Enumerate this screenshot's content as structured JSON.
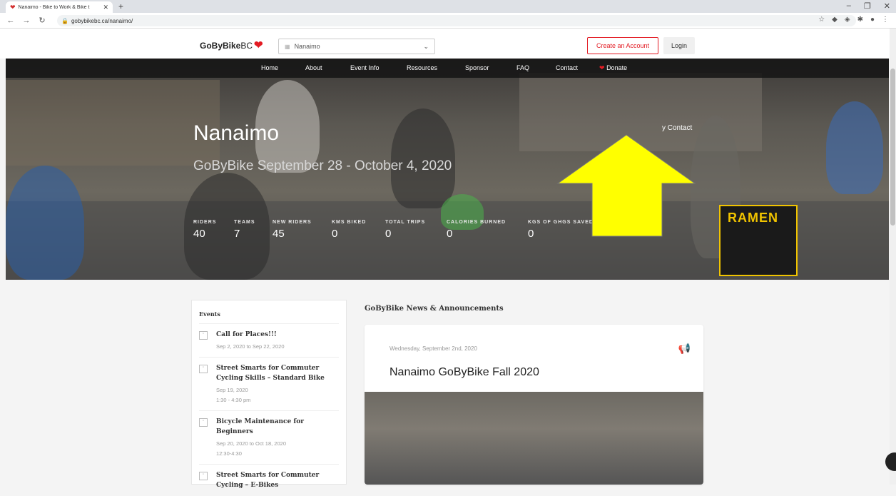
{
  "browser": {
    "tab_title": "Nanaimo - Bike to Work & Bike t",
    "url": "gobybikebc.ca/nanaimo/"
  },
  "header": {
    "logo_text": "GoByBike",
    "logo_suffix": "BC",
    "city_select": "Nanaimo",
    "create_account": "Create an Account",
    "login": "Login"
  },
  "nav": {
    "items": [
      "Home",
      "About",
      "Event Info",
      "Resources",
      "Sponsor",
      "FAQ",
      "Contact",
      "Donate"
    ]
  },
  "hero": {
    "title": "Nanaimo",
    "subtitle": "GoByBike September 28 - October 4, 2020",
    "contact_fragment": "y Contact",
    "sign_text": "RAMEN",
    "stats": [
      {
        "label": "RIDERS",
        "value": "40"
      },
      {
        "label": "TEAMS",
        "value": "7"
      },
      {
        "label": "NEW RIDERS",
        "value": "45"
      },
      {
        "label": "KMS BIKED",
        "value": "0"
      },
      {
        "label": "TOTAL TRIPS",
        "value": "0"
      },
      {
        "label": "CALORIES BURNED",
        "value": "0"
      },
      {
        "label": "KGS OF GHGS SAVED",
        "value": "0"
      }
    ]
  },
  "events": {
    "heading": "Events",
    "items": [
      {
        "title": "Call for Places!!!",
        "date": "Sep 2, 2020  to  Sep 22, 2020",
        "time": ""
      },
      {
        "title": "Street Smarts for Commuter Cycling Skills – Standard Bike",
        "date": "Sep 19, 2020",
        "time": "1:30 - 4:30 pm"
      },
      {
        "title": "Bicycle Maintenance for Beginners",
        "date": "Sep 20, 2020  to  Oct 18, 2020",
        "time": "12:30-4:30"
      },
      {
        "title": "Street Smarts for Commuter Cycling – E-Bikes",
        "date": "",
        "time": ""
      }
    ]
  },
  "news": {
    "heading": "GoByBike News & Announcements",
    "date": "Wednesday, September 2nd, 2020",
    "title": "Nanaimo GoByBike Fall 2020"
  },
  "colors": {
    "brand_red": "#e31b23",
    "arrow_yellow": "#ffff00",
    "nav_bg": "#141414"
  }
}
